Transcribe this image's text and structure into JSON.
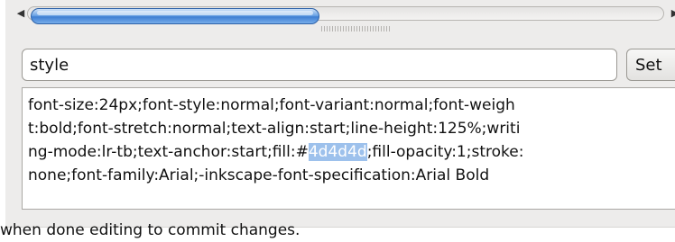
{
  "attribute_editor": {
    "name_field": {
      "value": "style"
    },
    "set_button": {
      "label": "Set"
    },
    "value_field": {
      "line1": "font-size:24px;font-style:normal;font-variant:normal;font-weigh",
      "line2": "t:bold;font-stretch:normal;text-align:start;line-height:125%;writi",
      "line3_before": "ng-mode:lr-tb;text-anchor:start;fill:#",
      "line3_selected": "4d4d4d",
      "line3_after": ";fill-opacity:1;stroke:",
      "line4": "none;font-family:Arial;-inkscape-font-specification:Arial Bold"
    },
    "hint": "when done editing to commit changes."
  },
  "scrollbar": {
    "left_arrow_icon": "triangle-left",
    "right_arrow_icon": "triangle-right"
  },
  "colors": {
    "selection": "#9dc1ec",
    "scroll_thumb": "#3f7fd3",
    "panel_background": "#edeceb"
  }
}
